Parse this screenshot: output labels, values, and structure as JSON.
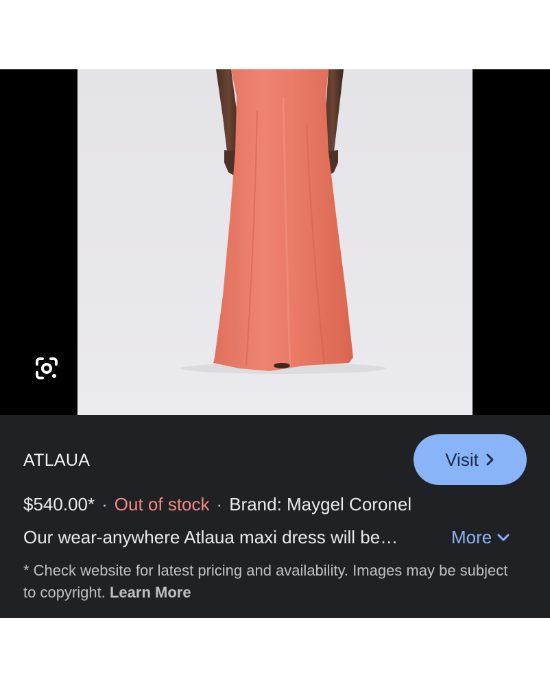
{
  "product": {
    "store_name": "ATLAUA",
    "price": "$540.00*",
    "separator": "·",
    "stock_status": "Out of stock",
    "brand": "Brand: Maygel Coronel",
    "description": "Our wear-anywhere Atlaua maxi dress will be…",
    "more_label": "More"
  },
  "actions": {
    "visit_label": "Visit"
  },
  "disclaimer": {
    "text": "* Check website for latest pricing and availability. Images may be subject to copyright.",
    "learn_more": "Learn More"
  },
  "icons": {
    "lens": "google-lens-icon",
    "visit_chevron": "chevron-right-icon",
    "more_chevron": "chevron-down-icon"
  },
  "colors": {
    "panel_bg": "#202124",
    "accent": "#8ab4f8",
    "out_of_stock": "#f28b82",
    "dress": "#e97a67"
  }
}
